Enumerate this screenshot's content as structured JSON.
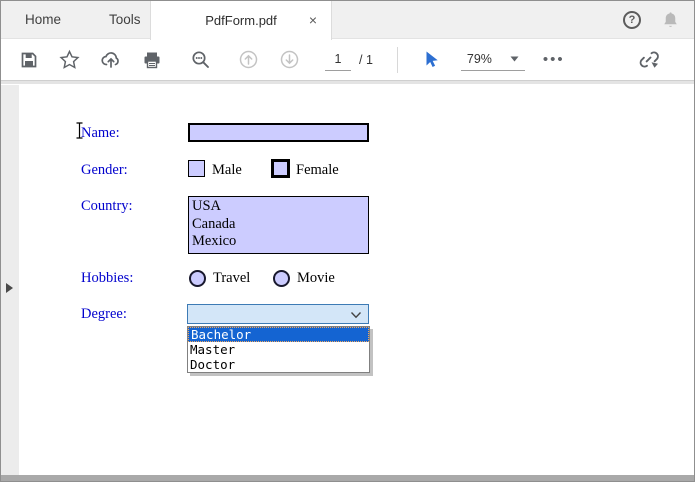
{
  "tabbar": {
    "home_label": "Home",
    "tools_label": "Tools",
    "document_tab_label": "PdfForm.pdf",
    "close_label": "×",
    "help_label": "?"
  },
  "toolbar": {
    "page_current": "1",
    "page_total": "/ 1",
    "zoom_level": "79%",
    "more_label": "•••"
  },
  "icons": {
    "left_group": [
      "save-icon",
      "star-icon",
      "cloud-upload-icon",
      "print-icon",
      "search-icon",
      "page-up-icon",
      "page-down-icon"
    ],
    "right_group": [
      "pointer-tool-icon",
      "zoom-caret-icon",
      "more-options-icon",
      "share-link-icon"
    ],
    "titlebar": [
      "help-icon",
      "bell-icon"
    ],
    "sidebar": [
      "expand-panel-arrow"
    ]
  },
  "form": {
    "name": {
      "label": "Name:",
      "value": ""
    },
    "gender": {
      "label": "Gender:",
      "options": [
        "Male",
        "Female"
      ]
    },
    "country": {
      "label": "Country:",
      "options": [
        "USA",
        "Canada",
        "Mexico"
      ]
    },
    "hobbies": {
      "label": "Hobbies:",
      "options": [
        "Travel",
        "Movie"
      ]
    },
    "degree": {
      "label": "Degree:",
      "selected_value": "",
      "options": [
        "Bachelor",
        "Master",
        "Doctor"
      ],
      "highlighted_option": "Bachelor"
    }
  },
  "colors": {
    "field_fill": "#ccccff",
    "label_blue": "#0101cd",
    "combo_fill": "#d3e6f8",
    "combo_border": "#3d7bb5",
    "dropdown_highlight": "#1464d2",
    "pointer_blue": "#2d6fd1",
    "tabbar_gray": "#f0f0f0"
  }
}
